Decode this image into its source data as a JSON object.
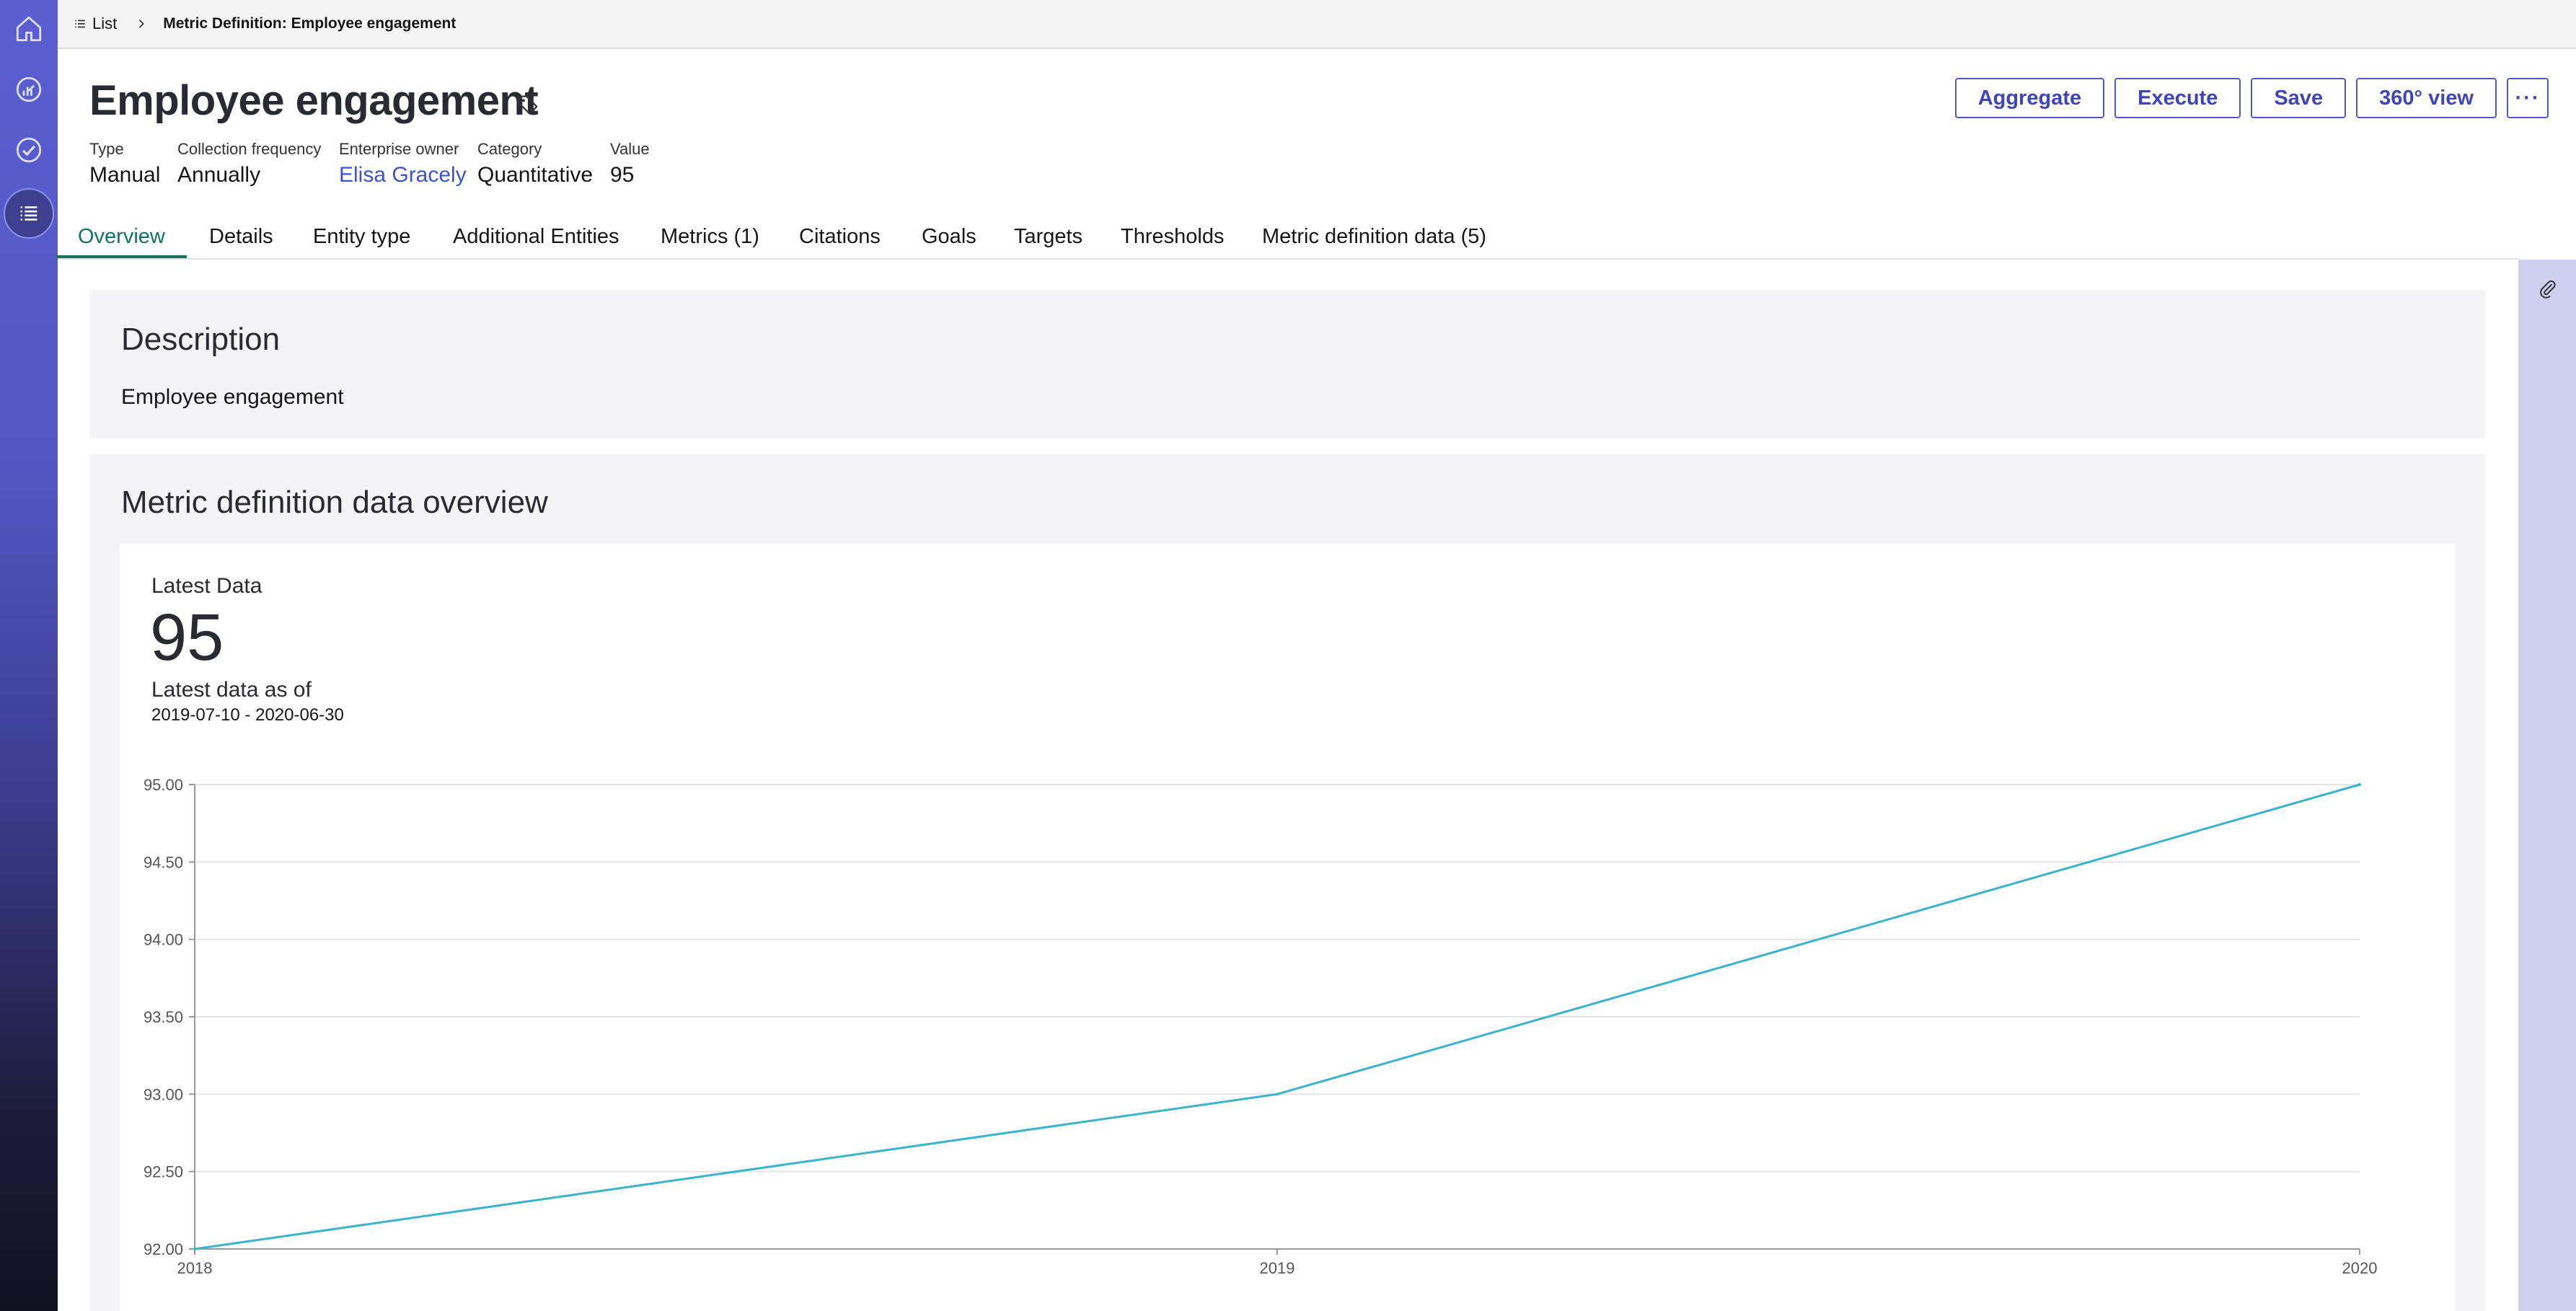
{
  "breadcrumb": {
    "list_label": "List",
    "current": "Metric Definition: Employee engagement"
  },
  "header": {
    "title": "Employee engagement",
    "fields": [
      {
        "label": "Type",
        "value": "Manual"
      },
      {
        "label": "Collection frequency",
        "value": "Annually"
      },
      {
        "label": "Enterprise owner",
        "value": "Elisa Gracely"
      },
      {
        "label": "Category",
        "value": "Quantitative"
      },
      {
        "label": "Value",
        "value": "95"
      }
    ],
    "actions": {
      "aggregate": "Aggregate",
      "execute": "Execute",
      "save": "Save",
      "view360": "360° view",
      "more": "···"
    }
  },
  "tabs": [
    {
      "label": "Overview",
      "active": true
    },
    {
      "label": "Details"
    },
    {
      "label": "Entity type"
    },
    {
      "label": "Additional Entities"
    },
    {
      "label": "Metrics (1)"
    },
    {
      "label": "Citations"
    },
    {
      "label": "Goals"
    },
    {
      "label": "Targets"
    },
    {
      "label": "Thresholds"
    },
    {
      "label": "Metric definition data (5)"
    }
  ],
  "description": {
    "title": "Description",
    "text": "Employee engagement"
  },
  "overview": {
    "title": "Metric definition data overview",
    "latest_label": "Latest Data",
    "latest_value": "95",
    "asof_label": "Latest data as of",
    "asof_range": "2019-07-10 - 2020-06-30"
  },
  "sidebar": {
    "items": [
      {
        "icon": "home-icon"
      },
      {
        "icon": "dashboard-icon"
      },
      {
        "icon": "check-circle-icon"
      },
      {
        "icon": "list-icon",
        "active": true
      }
    ]
  },
  "colors": {
    "accent": "#0f7561",
    "button": "#3f45b8",
    "line": "#3ab3cf",
    "link": "#3b53cf"
  },
  "chart_data": {
    "type": "line",
    "x": [
      "2018",
      "2019",
      "2020"
    ],
    "series": [
      {
        "values": [
          92.0,
          93.0,
          95.0
        ]
      }
    ],
    "yticks": [
      "92.00",
      "92.50",
      "93.00",
      "93.50",
      "94.00",
      "94.50",
      "95.00"
    ],
    "ylim": [
      92,
      95
    ],
    "grid": true
  }
}
